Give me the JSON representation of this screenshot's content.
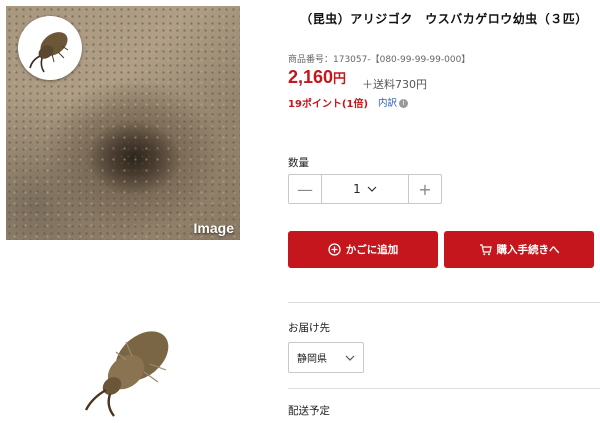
{
  "product": {
    "title": "（昆虫）アリジゴク　ウスバカゲロウ幼虫（３匹）",
    "sku": "商品番号：173057-【080-99-99-99-000】",
    "price": "2,160",
    "price_unit": "円",
    "shipping": "＋送料730円",
    "points": "19ポイント(1倍)",
    "breakdown_link": "内訳",
    "image_tag": "Image"
  },
  "quantity": {
    "label": "数量",
    "value": "1",
    "minus": "—",
    "plus": "+"
  },
  "actions": {
    "add_to_cart": "かごに追加",
    "checkout": "購入手続きへ"
  },
  "delivery": {
    "label": "お届け先",
    "selected": "静岡県",
    "schedule_label": "配送予定"
  },
  "colors": {
    "accent": "#c4161c",
    "link": "#2a60b8"
  }
}
